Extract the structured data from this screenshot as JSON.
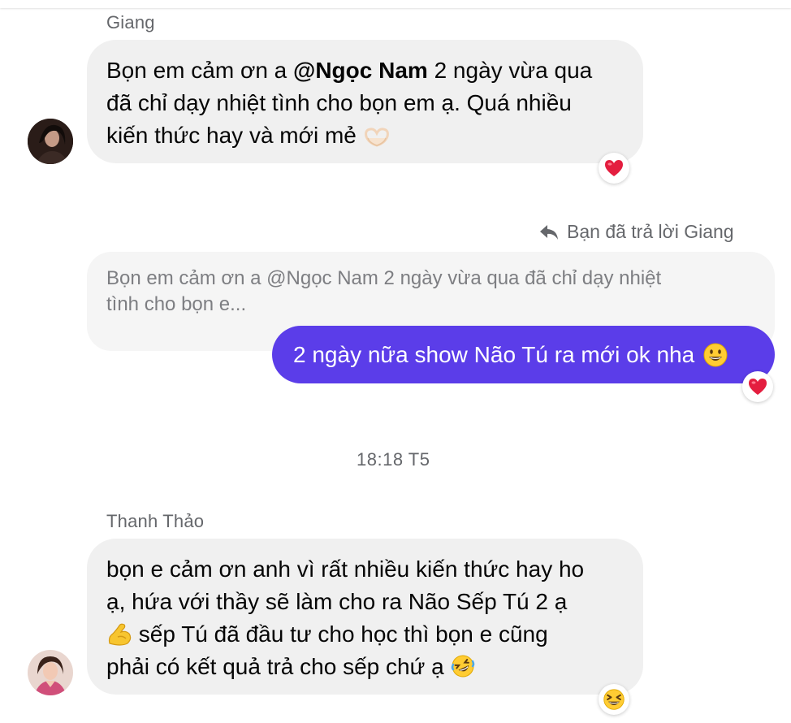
{
  "conversation": {
    "message1": {
      "sender": "Giang",
      "text_before_mention": "Bọn em cảm ơn a ",
      "mention": "@Ngọc Nam",
      "line1_after": " 2 ngày vừa qua",
      "line2": "đã chỉ dạy nhiệt tình cho bọn em ạ. Quá nhiều",
      "line3": "kiến thức hay và mới mẻ",
      "inline_icon": "heart-hands-emoji",
      "reaction": "heart-emoji"
    },
    "reply": {
      "header": "Bạn đã trả lời Giang",
      "header_icon": "reply-arrow-icon",
      "quoted_line1": "Bọn em cảm ơn a @Ngọc Nam 2 ngày vừa qua đã chỉ dạy nhiệt",
      "quoted_line2": "tình cho bọn e...",
      "text": "2 ngày nữa show Não Tú ra mới ok nha",
      "inline_icon": "grinning-face-emoji",
      "reaction": "heart-emoji"
    },
    "timestamp": "18:18 T5",
    "message2": {
      "sender": "Thanh Thảo",
      "line1": "bọn e cảm ơn anh vì rất nhiều kiến thức hay ho",
      "line2": "ạ, hứa với thầy sẽ làm cho ra Não Sếp Tú 2 ạ",
      "line3_after_icon": " sếp Tú đã đầu tư cho học thì bọn e cũng",
      "line4": "phải có kết quả trả cho sếp chứ ạ",
      "line3_icon": "flexed-biceps-emoji",
      "line4_icon": "rolling-laughing-emoji",
      "reaction": "grinning-squinting-emoji"
    }
  },
  "colors": {
    "outgoing_bubble": "#5b3de9",
    "incoming_bubble": "#f0f0f0",
    "meta_text": "#65676b"
  }
}
